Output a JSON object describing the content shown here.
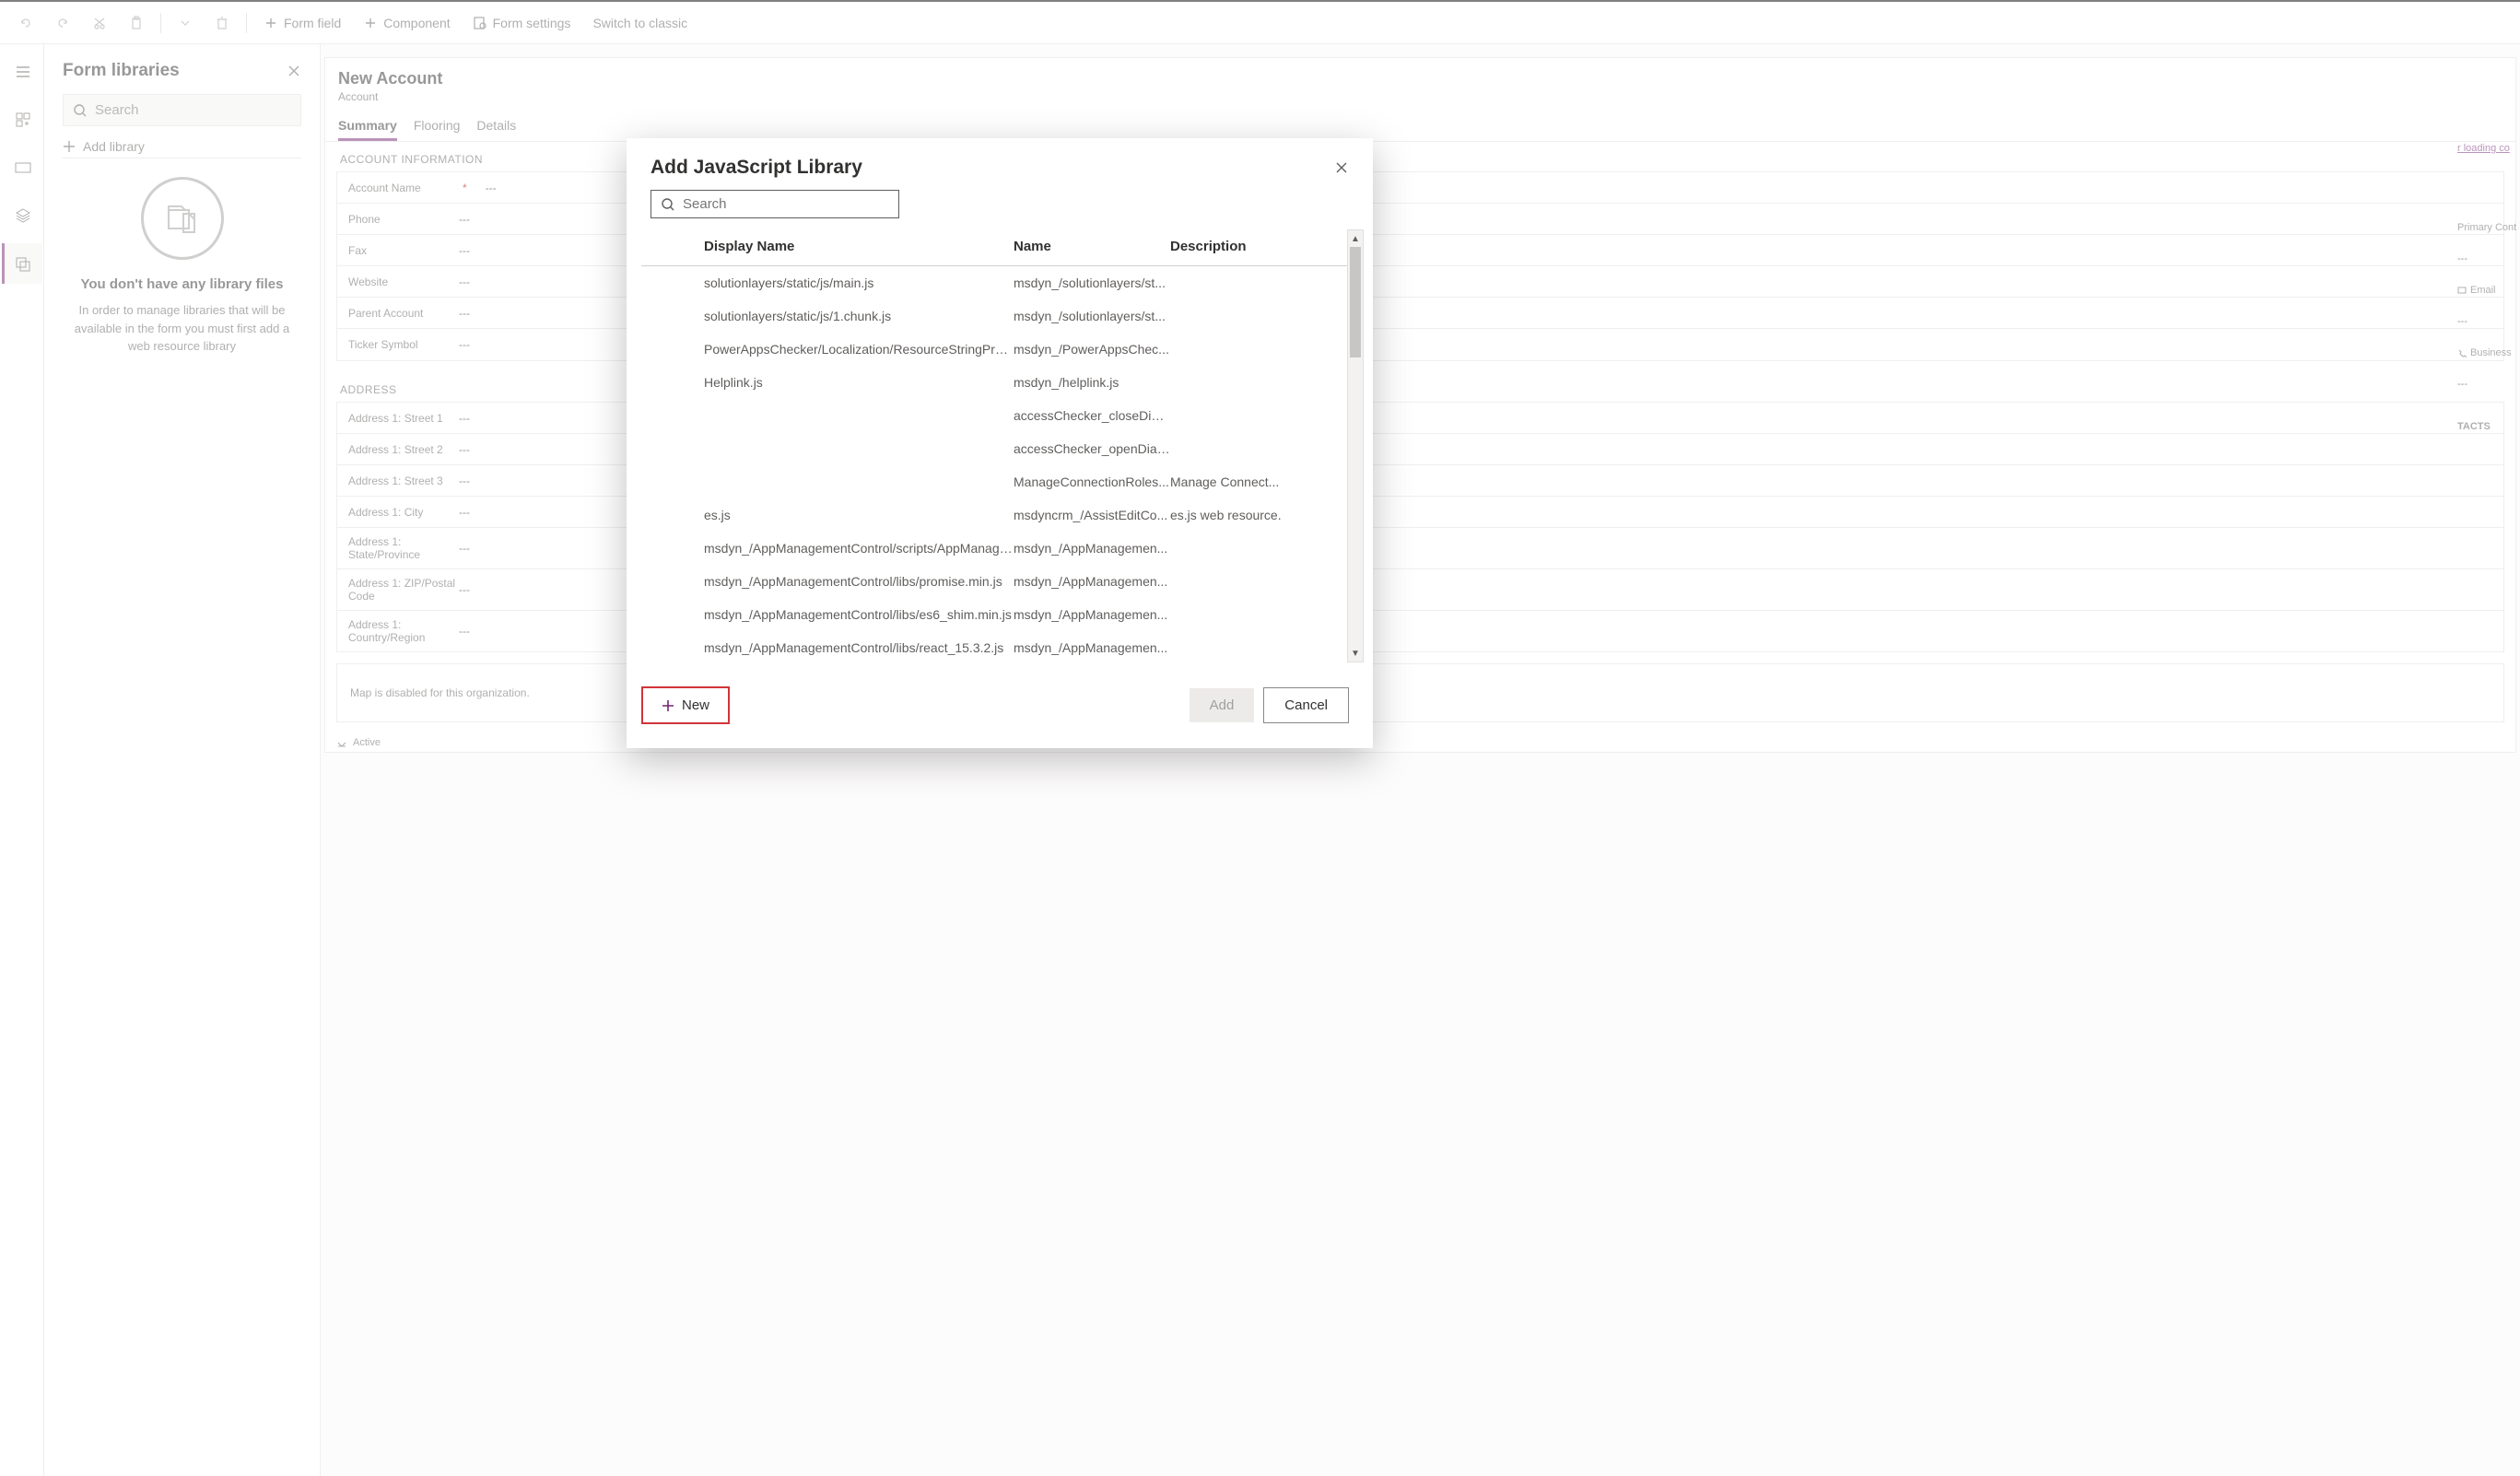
{
  "toolbar": {
    "form_field": "Form field",
    "component": "Component",
    "form_settings": "Form settings",
    "switch_classic": "Switch to classic"
  },
  "sidebar": {
    "title": "Form libraries",
    "search_placeholder": "Search",
    "add_library": "Add library",
    "empty_title": "You don't have any library files",
    "empty_text": "In order to manage libraries that will be available in the form you must first add a web resource library"
  },
  "form": {
    "title": "New Account",
    "entity": "Account",
    "tabs": [
      "Summary",
      "Flooring",
      "Details"
    ],
    "sections": {
      "account_info_title": "ACCOUNT INFORMATION",
      "account_info": [
        {
          "label": "Account Name",
          "value": "---",
          "required": true
        },
        {
          "label": "Phone",
          "value": "---"
        },
        {
          "label": "Fax",
          "value": "---"
        },
        {
          "label": "Website",
          "value": "---"
        },
        {
          "label": "Parent Account",
          "value": "---"
        },
        {
          "label": "Ticker Symbol",
          "value": "---"
        }
      ],
      "address_title": "ADDRESS",
      "address": [
        {
          "label": "Address 1: Street 1",
          "value": "---"
        },
        {
          "label": "Address 1: Street 2",
          "value": "---"
        },
        {
          "label": "Address 1: Street 3",
          "value": "---"
        },
        {
          "label": "Address 1: City",
          "value": "---"
        },
        {
          "label": "Address 1: State/Province",
          "value": "---"
        },
        {
          "label": "Address 1: ZIP/Postal Code",
          "value": "---"
        },
        {
          "label": "Address 1: Country/Region",
          "value": "---"
        }
      ],
      "map_msg": "Map is disabled for this organization.",
      "status": "Active"
    },
    "right_snippets": {
      "loading": "r loading co",
      "primary": "Primary Cont",
      "val1": "---",
      "email": "Email",
      "val2": "---",
      "business": "Business",
      "val3": "---",
      "contacts": "TACTS"
    }
  },
  "modal": {
    "title": "Add JavaScript Library",
    "search_placeholder": "Search",
    "columns": {
      "display_name": "Display Name",
      "name": "Name",
      "description": "Description"
    },
    "rows": [
      {
        "display": "solutionlayers/static/js/main.js",
        "name": "msdyn_/solutionlayers/st...",
        "desc": ""
      },
      {
        "display": "solutionlayers/static/js/1.chunk.js",
        "name": "msdyn_/solutionlayers/st...",
        "desc": ""
      },
      {
        "display": "PowerAppsChecker/Localization/ResourceStringProvid...",
        "name": "msdyn_/PowerAppsChec...",
        "desc": ""
      },
      {
        "display": "Helplink.js",
        "name": "msdyn_/helplink.js",
        "desc": ""
      },
      {
        "display": "",
        "name": "accessChecker_closeDial...",
        "desc": ""
      },
      {
        "display": "",
        "name": "accessChecker_openDial...",
        "desc": ""
      },
      {
        "display": "",
        "name": "ManageConnectionRoles...",
        "desc": "Manage Connect..."
      },
      {
        "display": "es.js",
        "name": "msdyncrm_/AssistEditCo...",
        "desc": "es.js web resource."
      },
      {
        "display": "msdyn_/AppManagementControl/scripts/AppManage...",
        "name": "msdyn_/AppManagemen...",
        "desc": ""
      },
      {
        "display": "msdyn_/AppManagementControl/libs/promise.min.js",
        "name": "msdyn_/AppManagemen...",
        "desc": ""
      },
      {
        "display": "msdyn_/AppManagementControl/libs/es6_shim.min.js",
        "name": "msdyn_/AppManagemen...",
        "desc": ""
      },
      {
        "display": "msdyn_/AppManagementControl/libs/react_15.3.2.js",
        "name": "msdyn_/AppManagemen...",
        "desc": ""
      }
    ],
    "new_label": "New",
    "add_label": "Add",
    "cancel_label": "Cancel"
  }
}
